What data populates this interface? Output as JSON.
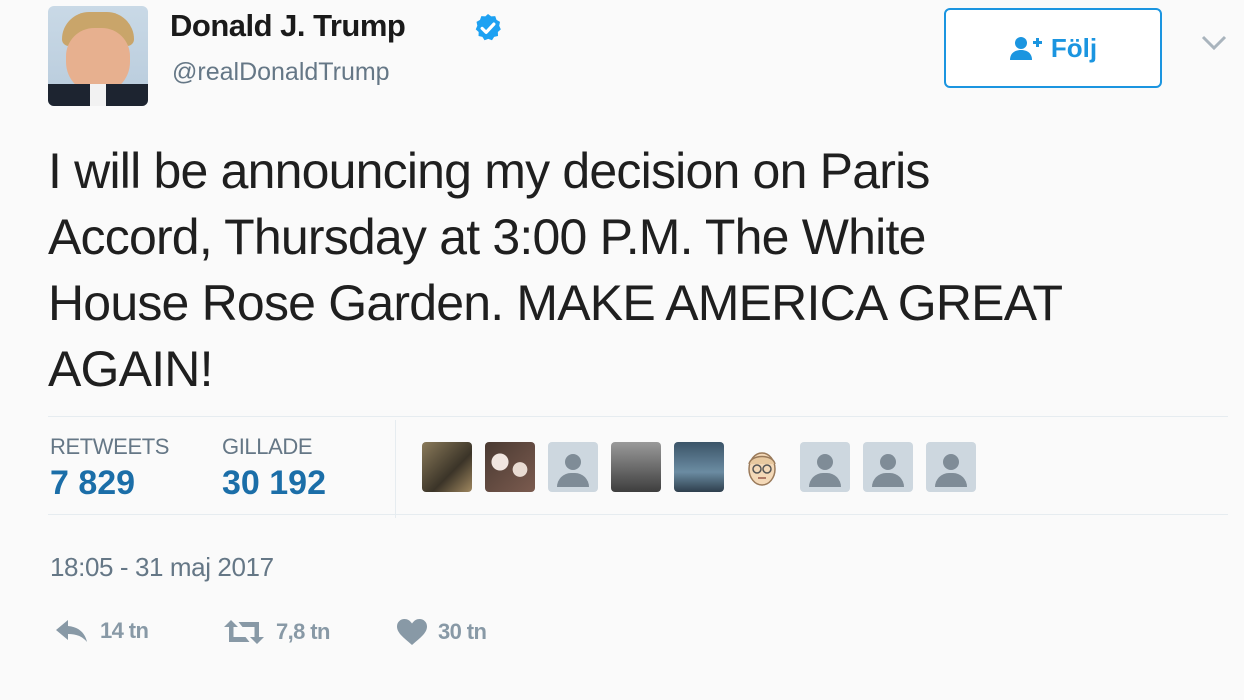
{
  "author": {
    "name": "Donald J. Trump",
    "handle": "@realDonaldTrump",
    "avatar_icon": "profile-photo",
    "verified_icon": "verified-badge-icon",
    "verified_color": "#1da1f2"
  },
  "follow": {
    "label": "Följ",
    "icon": "add-user-icon",
    "color": "#1b95e0"
  },
  "menu": {
    "icon": "chevron-down-icon"
  },
  "tweet": {
    "text": "I will be announcing my decision on Paris\nAccord, Thursday at 3:00 P.M.  The White\nHouse Rose Garden.  MAKE AMERICA GREAT\nAGAIN!"
  },
  "stats": {
    "retweets_label": "RETWEETS",
    "retweets_value": "7 829",
    "likes_label": "GILLADE",
    "likes_value": "30 192",
    "value_color": "#1b6ea8"
  },
  "likers": [
    "photo",
    "photo",
    "default-avatar",
    "photo",
    "photo",
    "cartoon",
    "default-avatar",
    "default-avatar",
    "default-avatar"
  ],
  "timestamp": "18:05 - 31 maj 2017",
  "actions": {
    "reply_icon": "reply-icon",
    "reply_count": "14 tn",
    "retweet_icon": "retweet-icon",
    "retweet_count": "7,8 tn",
    "like_icon": "heart-icon",
    "like_count": "30 tn"
  }
}
